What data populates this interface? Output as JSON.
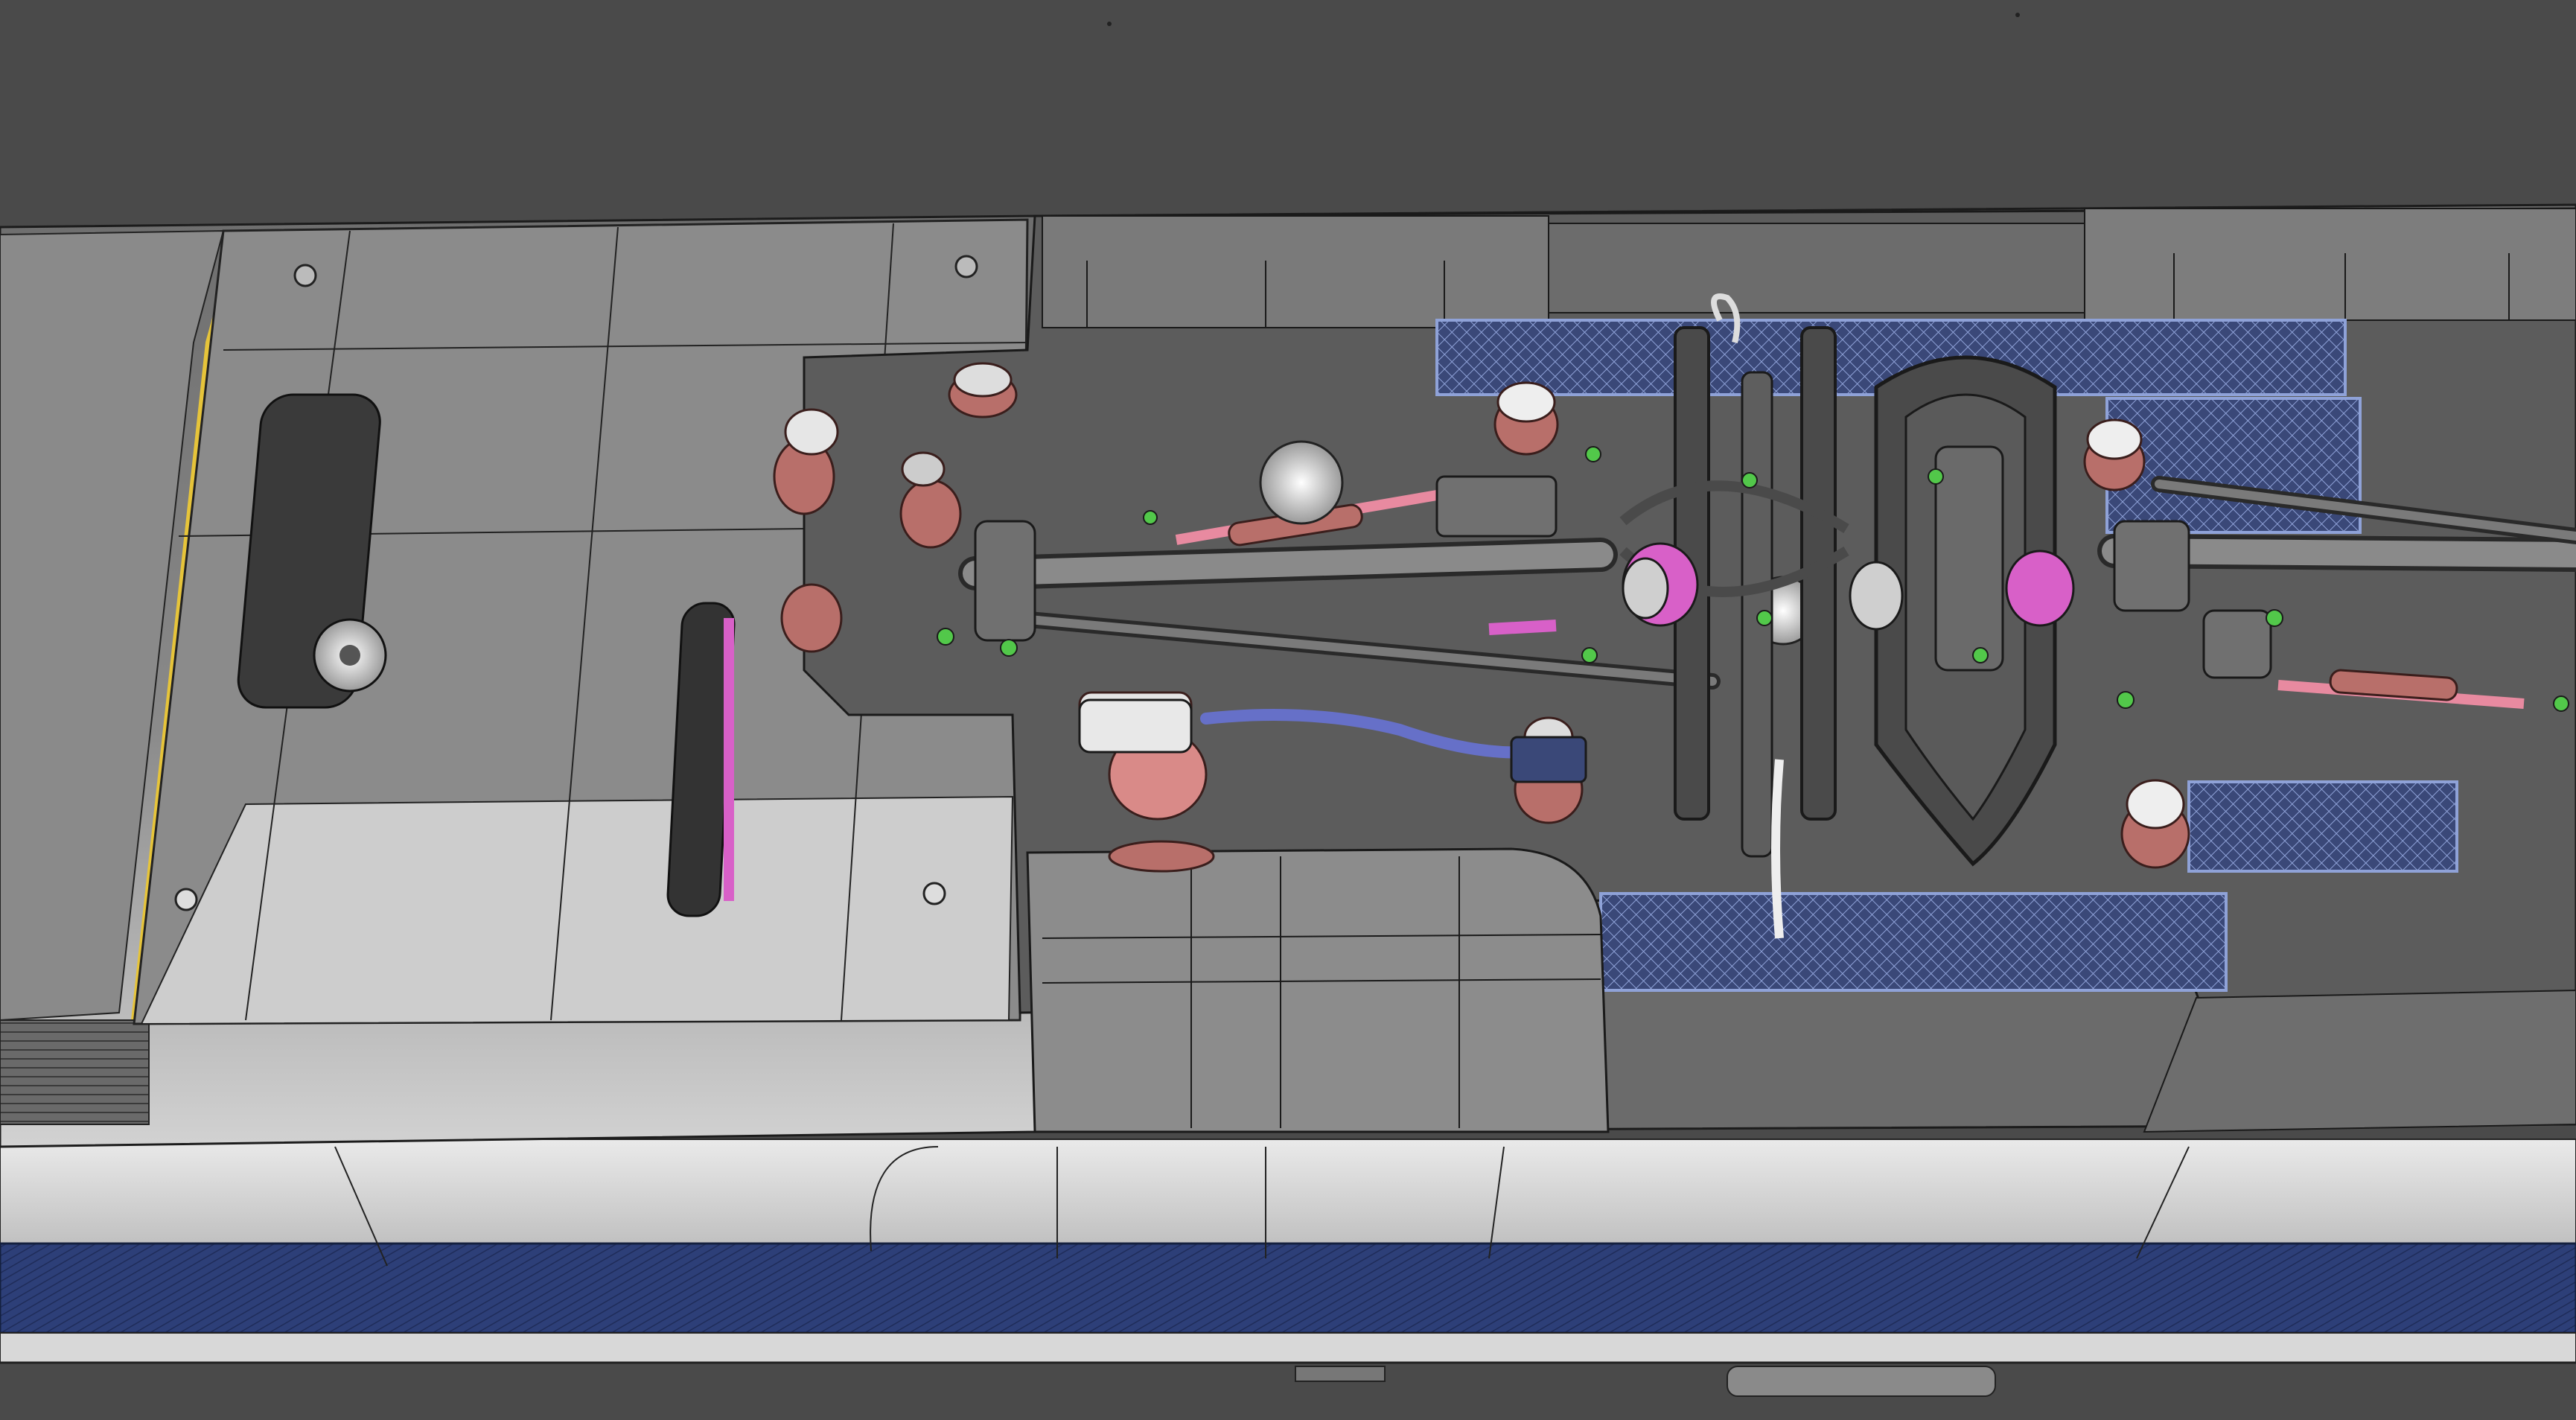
{
  "viewport": {
    "background": "#4a4a4a",
    "background_alt": "#505050"
  },
  "palette": {
    "roof_dark": "#5b5b5b",
    "roof_mid": "#7d7d7d",
    "roof_light": "#cfcfcf",
    "body_light": "#e4e4e4",
    "body_shadow": "#9a9a9a",
    "stripe_blue": "#2d3f78",
    "stripe_blue_dark": "#1f2c59",
    "grating_blue": "#3a4878",
    "grating_line": "#8fa2d8",
    "insulator_red": "#b86f6a",
    "insulator_pink": "#d98a88",
    "pantograph_pink": "#e88aa0",
    "magenta": "#d860c8",
    "green_bolt": "#52c84a",
    "yellow_edge": "#e6c43a",
    "wire": "#1a1a1a",
    "cable_blue": "#6670c8"
  },
  "objects": {
    "train_roof": "train-roof",
    "pantographs": 2,
    "walkway_gratings": 4,
    "rooftop_insulators": 10
  }
}
